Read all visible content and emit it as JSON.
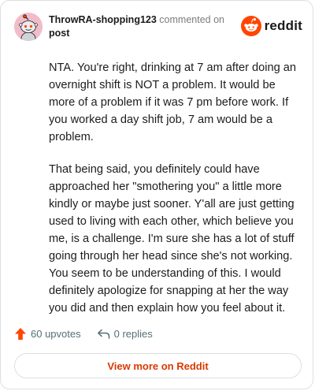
{
  "header": {
    "username": "ThrowRA-shopping123",
    "action_text": "commented on",
    "post_link": "post",
    "brand": "reddit"
  },
  "comment": {
    "paragraphs": [
      "NTA. You're right, drinking at 7 am after doing an overnight shift is NOT a problem. It would be more of a problem if it was 7 pm before work. If you worked a day shift job, 7 am would be a problem.",
      "That being said, you definitely could have approached her \"smothering you\" a little more kindly or maybe just sooner. Y'all are just getting used to living with each other, which believe you me, is a challenge. I'm sure she has a lot of stuff going through her head since she's not working. You seem to be understanding of this. I would definitely apologize for snapping at her the way you did and then explain how you feel about it."
    ]
  },
  "actions": {
    "upvotes_label": "60 upvotes",
    "replies_label": "0 replies"
  },
  "footer": {
    "view_more_label": "View more on Reddit"
  },
  "colors": {
    "brand_orange": "#ff4500",
    "link_orange": "#d93a00",
    "avatar_bg": "#f1bcc9"
  },
  "icons": {
    "avatar": "snoo-avatar-icon",
    "brand": "reddit-logo-icon",
    "upvote": "upvote-arrow-icon",
    "reply": "reply-arrow-icon"
  }
}
